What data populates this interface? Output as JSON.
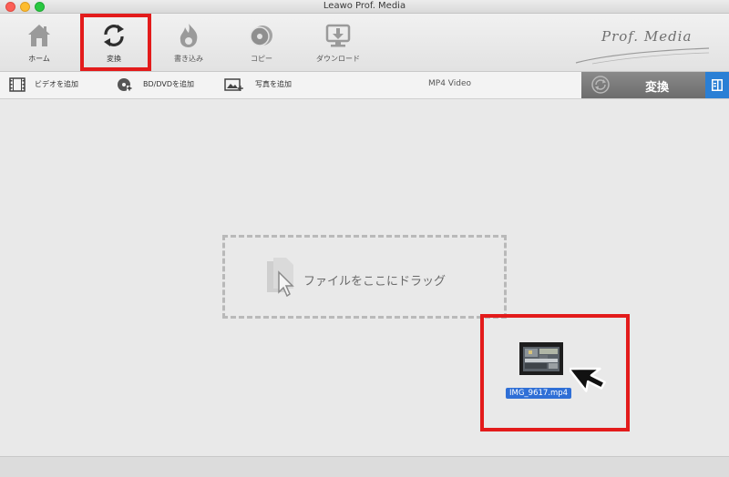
{
  "window": {
    "title": "Leawo Prof. Media"
  },
  "toolbar": {
    "items": [
      {
        "label": "ホーム",
        "icon": "home-icon"
      },
      {
        "label": "変換",
        "icon": "convert-icon"
      },
      {
        "label": "書き込み",
        "icon": "burn-icon"
      },
      {
        "label": "コピー",
        "icon": "copy-disc-icon"
      },
      {
        "label": "ダウンロード",
        "icon": "download-icon"
      }
    ],
    "logo_text": "Prof. Media"
  },
  "subbar": {
    "add_video": "ビデオを追加",
    "add_bd_dvd": "BD/DVDを追加",
    "add_photo": "写真を追加",
    "format": "MP4 Video",
    "convert_label": "変換"
  },
  "dropzone": {
    "text": "ファイルをここにドラッグ"
  },
  "dragged_file": {
    "name": "IMG_9617.mp4"
  },
  "colors": {
    "highlight": "#e31b1b",
    "accent": "#2f6fd6"
  }
}
